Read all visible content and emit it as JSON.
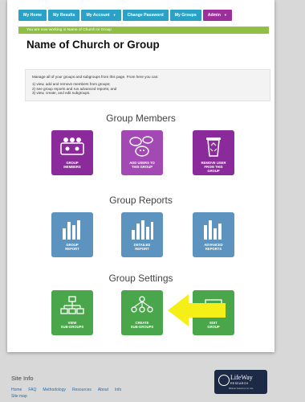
{
  "nav": {
    "tabs": [
      {
        "label": "My Home"
      },
      {
        "label": "My Results"
      },
      {
        "label": "My Account"
      },
      {
        "label": "Change Password"
      },
      {
        "label": "My Groups"
      },
      {
        "label": "Admin"
      }
    ],
    "dropdown_caret": "▼"
  },
  "notice": "You are now working in Name of Church or Group",
  "page_title": "Name of Church or Group",
  "info": {
    "intro": "Manage all of your groups and subgroups from this page. From here you can:",
    "items": [
      "1) view, add and remove members from groups;",
      "2) see group reports and run advanced reports; and",
      "3) view, create, and edit subgroups."
    ]
  },
  "sections": {
    "members": {
      "title": "Group Members",
      "tiles": [
        {
          "label_1": "GROUP",
          "label_2": "MEMBERS",
          "label_3": ""
        },
        {
          "label_1": "ADD USERS TO",
          "label_2": "THIS GROUP",
          "label_3": ""
        },
        {
          "label_1": "REMOVE USER",
          "label_2": "FROM THIS",
          "label_3": "GROUP"
        }
      ]
    },
    "reports": {
      "title": "Group Reports",
      "tiles": [
        {
          "label_1": "GROUP",
          "label_2": "REPORT"
        },
        {
          "label_1": "DETAILED",
          "label_2": "REPORT"
        },
        {
          "label_1": "ADVANCED",
          "label_2": "REPORTS"
        }
      ]
    },
    "settings": {
      "title": "Group Settings",
      "tiles": [
        {
          "label_1": "VIEW",
          "label_2": "SUB-GROUPS"
        },
        {
          "label_1": "CREATE",
          "label_2": "SUB-GROUPS"
        },
        {
          "label_1": "EDIT",
          "label_2": "GROUP"
        }
      ]
    }
  },
  "footer": {
    "title": "Site Info",
    "links": [
      "Home",
      "FAQ",
      "Methodology",
      "Resources",
      "About",
      "Info"
    ],
    "sitemap": "Site map"
  },
  "logo": {
    "name": "LifeWay",
    "sub": "RESEARCH",
    "tagline": "Biblical Solutions for Life"
  },
  "colors": {
    "nav_teal": "#2aa2c7",
    "nav_admin": "#9c2f9c",
    "notice_green": "#8fc045",
    "members_purple": "#8b2a9b",
    "reports_blue": "#5d94bf",
    "settings_green": "#4aa64a",
    "highlight_arrow": "#f5ef18"
  }
}
